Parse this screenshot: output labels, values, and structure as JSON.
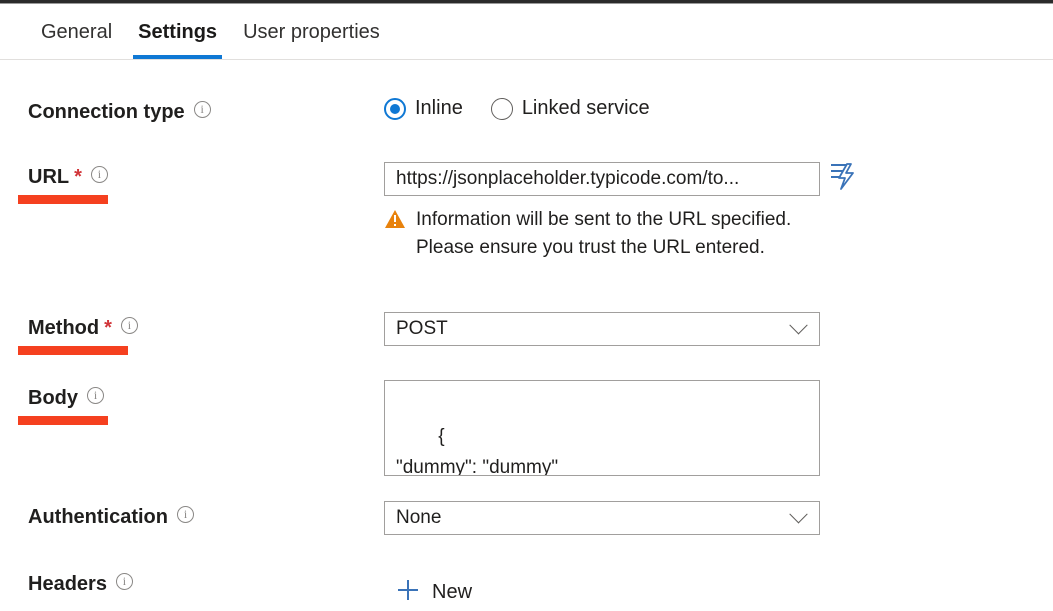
{
  "tabs": [
    {
      "label": "General",
      "active": false
    },
    {
      "label": "Settings",
      "active": true
    },
    {
      "label": "User properties",
      "active": false
    }
  ],
  "accent_color": "#0f78d4",
  "annotation_color": "#f5401f",
  "warning_color": "#e8820c",
  "required_color": "#d13438",
  "fields": {
    "connection_type": {
      "label": "Connection type",
      "info_icon": "info-icon",
      "options": [
        {
          "label": "Inline",
          "selected": true
        },
        {
          "label": "Linked service",
          "selected": false
        }
      ]
    },
    "url": {
      "label": "URL",
      "required": "*",
      "info_icon": "info-icon",
      "value": "https://jsonplaceholder.typicode.com/to...",
      "dynamic_content_icon": "dynamic-content-lightning-icon",
      "warning_icon": "warning-triangle-icon",
      "warning_text": "Information will be sent to the URL specified. Please ensure you trust the URL entered.",
      "annotated": true
    },
    "method": {
      "label": "Method",
      "required": "*",
      "info_icon": "info-icon",
      "value": "POST",
      "chevron_icon": "chevron-down-icon",
      "annotated": true
    },
    "body": {
      "label": "Body",
      "info_icon": "info-icon",
      "value": "{\n\"dummy\": \"dummy\"\n}",
      "resize_icon": "resize-grip-icon",
      "annotated": true
    },
    "authentication": {
      "label": "Authentication",
      "info_icon": "info-icon",
      "value": "None",
      "chevron_icon": "chevron-down-icon",
      "annotated": false
    },
    "headers": {
      "label": "Headers",
      "info_icon": "info-icon",
      "new_label": "New",
      "plus_icon": "plus-icon"
    }
  }
}
